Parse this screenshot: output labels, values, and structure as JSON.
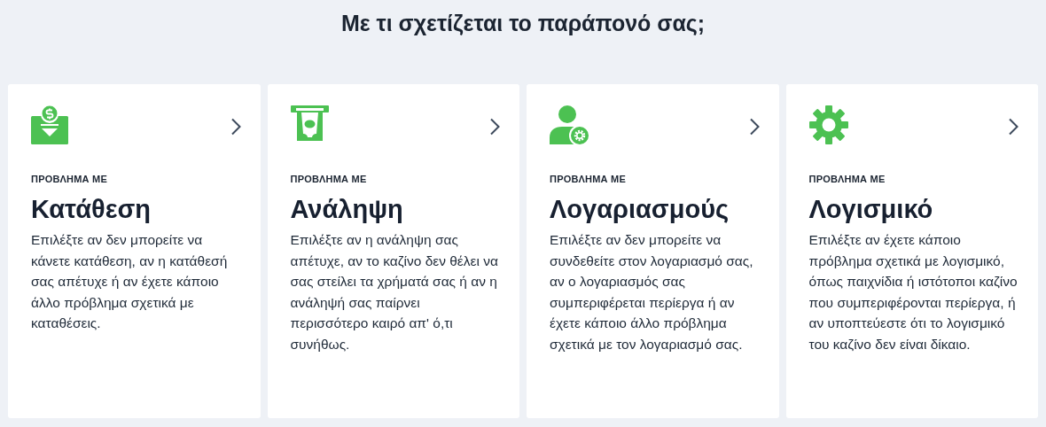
{
  "heading": "Με τι σχετίζεται το παράπονό σας;",
  "cards": [
    {
      "kind": "deposit",
      "label": "ΠΡΟΒΛΗΜΑ ΜΕ",
      "title": "Κατάθεση",
      "description": "Επιλέξτε αν δεν μπορείτε να κάνετε κατάθεση, αν η κατάθεσή σας απέτυχε ή αν έχετε κάποιο άλλο πρόβλημα σχετικά με καταθέσεις."
    },
    {
      "kind": "withdrawal",
      "label": "ΠΡΟΒΛΗΜΑ ΜΕ",
      "title": "Ανάληψη",
      "description": "Επιλέξτε αν η ανάληψη σας απέτυχε, αν το καζίνο δεν θέλει να σας στείλει τα χρήματά σας ή αν η ανάληψή σας παίρνει περισσότερο καιρό απ' ό,τι συνήθως."
    },
    {
      "kind": "account",
      "label": "ΠΡΟΒΛΗΜΑ ΜΕ",
      "title": "Λογαριασμούς",
      "description": "Επιλέξτε αν δεν μπορείτε να συνδεθείτε στον λογαριασμό σας, αν ο λογαριασμός σας συμπεριφέρεται περίεργα ή αν έχετε κάποιο άλλο πρόβλημα σχετικά με τον λογαριασμό σας."
    },
    {
      "kind": "software",
      "label": "ΠΡΟΒΛΗΜΑ ΜΕ",
      "title": "Λογισμικό",
      "description": "Επιλέξτε αν έχετε κάποιο πρόβλημα σχετικά με λογισμικό, όπως παιχνίδια ή ιστότοποι καζίνο που συμπεριφέρονται περίεργα, ή αν υποπτεύεστε ότι το λογισμικό του καζίνο δεν είναι δίκαιο."
    }
  ]
}
